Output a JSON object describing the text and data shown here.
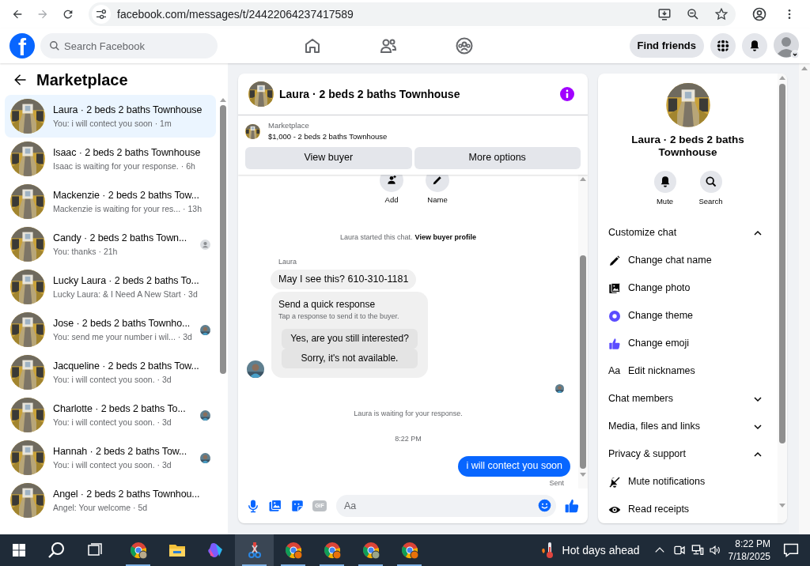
{
  "browser": {
    "url": "facebook.com/messages/t/24422064237417589"
  },
  "header": {
    "logo": "f",
    "search_placeholder": "Search Facebook",
    "find_friends": "Find friends"
  },
  "sidebar": {
    "title": "Marketplace",
    "conversations": [
      {
        "title": "Laura · 2 beds 2 baths Townhouse",
        "preview": "You: i will contect you soon",
        "time": "· 1m",
        "selected": true
      },
      {
        "title": "Isaac · 2 beds 2 baths Townhouse",
        "preview": "Isaac is waiting for your response.",
        "time": "· 6h",
        "selected": false
      },
      {
        "title": "Mackenzie · 2 beds 2 baths Tow...",
        "preview": "Mackenzie is waiting for your res...",
        "time": "· 13h",
        "selected": false
      },
      {
        "title": "Candy · 2 beds 2 baths Town...",
        "preview": "You: thanks",
        "time": "· 21h",
        "selected": false,
        "seen": {
          "kind": "silhouette"
        }
      },
      {
        "title": "Lucky Laura · 2 beds 2 baths To...",
        "preview": "Lucky Laura: & I Need A New Start",
        "time": "· 3d",
        "selected": false
      },
      {
        "title": "Jose · 2 beds 2 baths Townho...",
        "preview": "You: send me your number i wil...",
        "time": "· 3d",
        "selected": false
      },
      {
        "title": "Jacqueline · 2 beds 2 baths Tow...",
        "preview": "You: i will contect you soon.",
        "time": "· 3d",
        "selected": false
      },
      {
        "title": "Charlotte · 2 beds 2 baths To...",
        "preview": "You: i will contect you soon.",
        "time": "· 3d",
        "selected": false
      },
      {
        "title": "Hannah · 2 beds 2 baths Tow...",
        "preview": "You: i will contect you soon.",
        "time": "· 3d",
        "selected": false
      },
      {
        "title": "Angel · 2 beds 2 baths Townhou...",
        "preview": "Angel: Your welcome",
        "time": "· 5d",
        "selected": false
      }
    ]
  },
  "chat": {
    "title": "Laura · 2 beds 2 baths Townhouse",
    "listing": {
      "label": "Marketplace",
      "price_title": "$1,000 - 2 beds 2 baths Townhouse",
      "buttons": [
        "View buyer",
        "More options"
      ]
    },
    "actions": [
      "Add",
      "Name"
    ],
    "started": "Laura started this chat.",
    "profile_link": "View buyer profile",
    "sender": "Laura",
    "incoming": "May I see this? 610-310-1181",
    "quick": {
      "title": "Send a quick response",
      "subtitle": "Tap a response to send it to the buyer.",
      "options": [
        "Yes, are you still interested?",
        "Sorry, it's not available."
      ]
    },
    "waiting": "Laura is waiting for your response.",
    "timestamp": "8:22 PM",
    "outgoing": "i will contect you soon",
    "status": "Sent",
    "composer": {
      "gif": "GIF",
      "placeholder": "Aa"
    }
  },
  "details": {
    "title": "Laura · 2 beds 2 baths Townhouse",
    "actions": [
      "Mute",
      "Search"
    ],
    "items": [
      {
        "kind": "section",
        "label": "Customize chat",
        "expanded": true
      },
      {
        "kind": "item",
        "label": "Change chat name"
      },
      {
        "kind": "item",
        "label": "Change photo"
      },
      {
        "kind": "item",
        "label": "Change theme"
      },
      {
        "kind": "item",
        "label": "Change emoji"
      },
      {
        "kind": "glyph",
        "glyph": "Aa",
        "label": "Edit nicknames"
      },
      {
        "kind": "section",
        "label": "Chat members",
        "expanded": false
      },
      {
        "kind": "section",
        "label": "Media, files and links",
        "expanded": false
      },
      {
        "kind": "section",
        "label": "Privacy & support",
        "expanded": true
      },
      {
        "kind": "item",
        "label": "Mute notifications"
      },
      {
        "kind": "item",
        "label": "Read receipts"
      }
    ]
  },
  "taskbar": {
    "apps": [
      {
        "open": true,
        "selected": false
      },
      {
        "open": false,
        "selected": false
      },
      {
        "open": false,
        "selected": false
      },
      {
        "open": true,
        "selected": true
      },
      {
        "open": true,
        "selected": false
      },
      {
        "open": true,
        "selected": false
      },
      {
        "open": true,
        "selected": false
      },
      {
        "open": true,
        "selected": false
      }
    ],
    "weather": "Hot days ahead",
    "time": "8:22 PM",
    "date": "7/18/2025"
  }
}
